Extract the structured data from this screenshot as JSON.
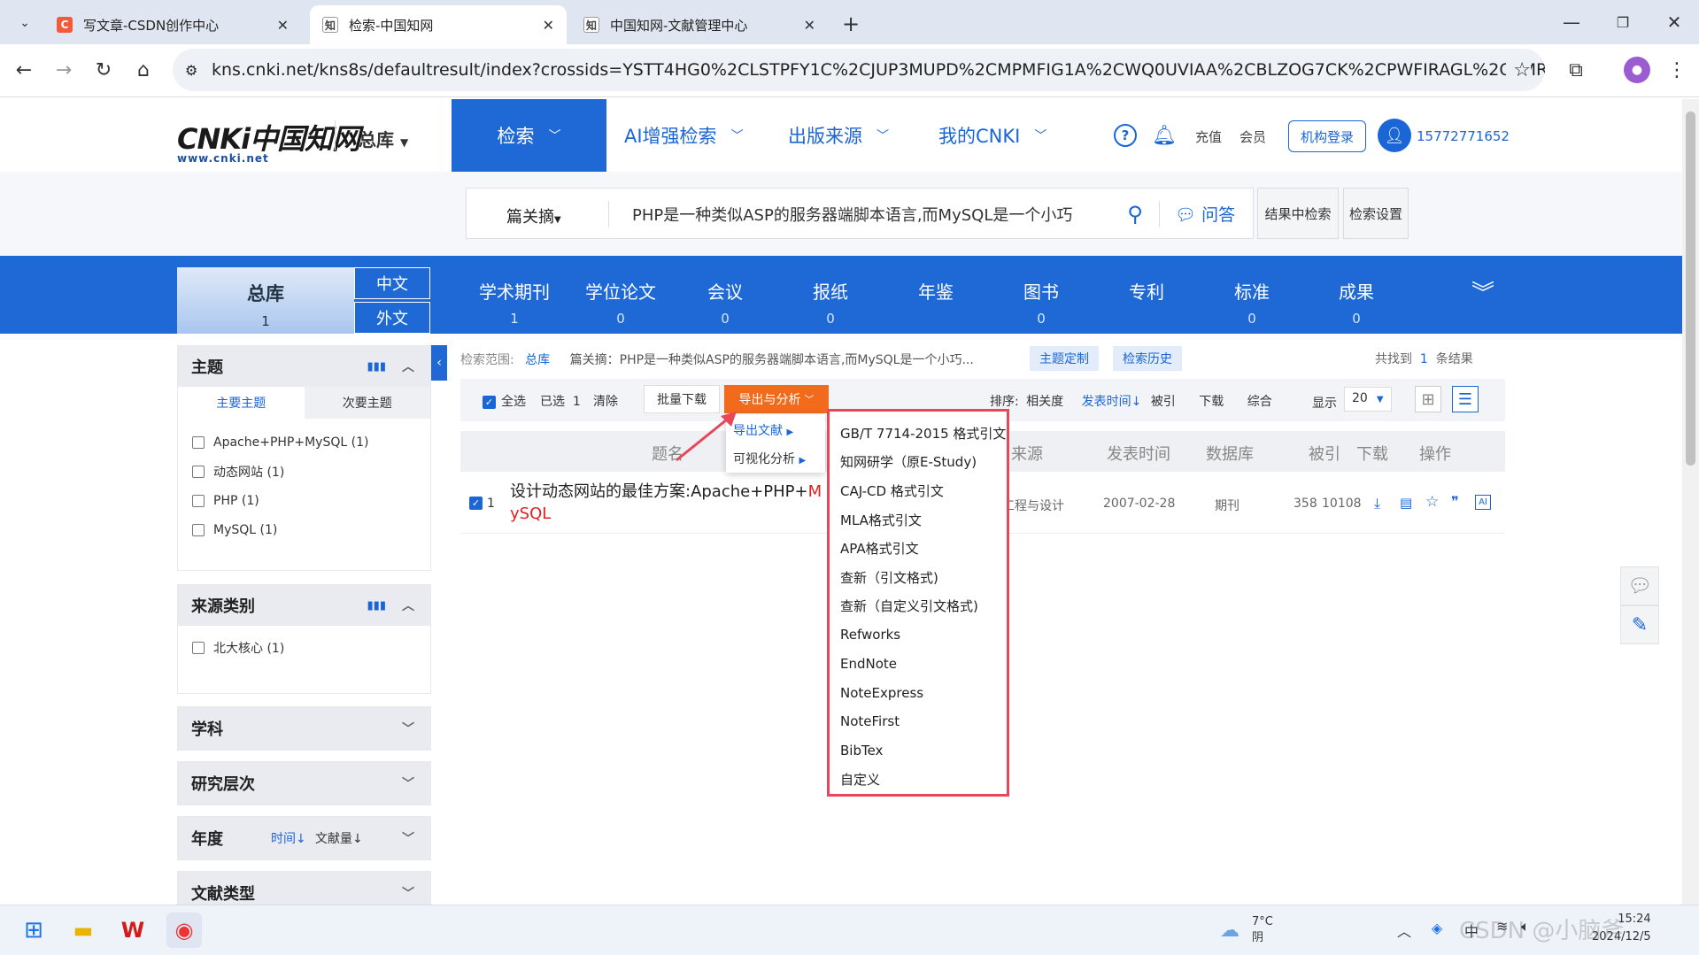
{
  "browser": {
    "tabs": [
      {
        "label": "写文章-CSDN创作中心",
        "fav": "C",
        "color": "#f25a3b"
      },
      {
        "label": "检索-中国知网",
        "fav": "知",
        "color": "#555"
      },
      {
        "label": "中国知网-文献管理中心",
        "fav": "知",
        "color": "#555"
      }
    ],
    "url": "kns.cnki.net/kns8s/defaultresult/index?crossids=YSTT4HG0%2CLSTPFY1C%2CJUP3MUPD%2CMPMFIG1A%2CWQ0UVIAA%2CBLZOG7CK%2CPWFIRAGL%2CEMRPGLPA%2C..."
  },
  "header": {
    "logo": "CNKi中国知网",
    "logo_sub": "www.cnki.net",
    "library": "总库",
    "nav": [
      "检索",
      "AI增强检索",
      "出版来源",
      "我的CNKI"
    ],
    "recharge": "充值",
    "member": "会员",
    "org_login": "机构登录",
    "user": "15772771652"
  },
  "search": {
    "field": "篇关摘",
    "query": "PHP是一种类似ASP的服务器端脚本语言,而MySQL是一个小巧",
    "qa": "问答",
    "in_results": "结果中检索",
    "settings": "检索设置"
  },
  "categories": {
    "main": {
      "label": "总库",
      "count": "1"
    },
    "zh": "中文",
    "foreign": "外文",
    "items": [
      {
        "label": "学术期刊",
        "count": "1"
      },
      {
        "label": "学位论文",
        "count": "0"
      },
      {
        "label": "会议",
        "count": "0"
      },
      {
        "label": "报纸",
        "count": "0"
      },
      {
        "label": "年鉴",
        "count": ""
      },
      {
        "label": "图书",
        "count": "0"
      },
      {
        "label": "专利",
        "count": ""
      },
      {
        "label": "标准",
        "count": "0"
      },
      {
        "label": "成果",
        "count": "0"
      }
    ]
  },
  "sidebar": {
    "topic": {
      "title": "主题",
      "tab1": "主要主题",
      "tab2": "次要主题",
      "items": [
        "Apache+PHP+MySQL (1)",
        "动态网站 (1)",
        "PHP (1)",
        "MySQL (1)"
      ]
    },
    "source": {
      "title": "来源类别",
      "items": [
        "北大核心 (1)"
      ]
    },
    "subject": "学科",
    "level": "研究层次",
    "year": {
      "title": "年度",
      "sort1": "时间",
      "sort2": "文献量"
    },
    "doctype": "文献类型"
  },
  "results": {
    "scope_label": "检索范围:",
    "scope_value": "总库",
    "scope_query": "篇关摘：PHP是一种类似ASP的服务器端脚本语言,而MySQL是一个小巧...",
    "theme_btn": "主题定制",
    "history_btn": "检索历史",
    "found_prefix": "共找到",
    "found_count": "1",
    "found_suffix": "条结果",
    "select_all": "全选",
    "selected": "已选",
    "selected_count": "1",
    "clear": "清除",
    "batch_download": "批量下载",
    "export": "导出与分析",
    "sort_label": "排序:",
    "sort_relevance": "相关度",
    "sort_date": "发表时间",
    "sort_cited": "被引",
    "sort_download": "下载",
    "sort_overall": "综合",
    "show_label": "显示",
    "page_size": "20",
    "columns": [
      "题名",
      "来源",
      "发表时间",
      "数据库",
      "被引",
      "下载",
      "操作"
    ],
    "row": {
      "index": "1",
      "title_a": "设计动态网站的最佳方案:Apache+PHP+",
      "title_hl1": "M",
      "title_hl2": "ySQL",
      "source": "工程与设计",
      "date": "2007-02-28",
      "db": "期刊",
      "cited": "358",
      "downloads": "10108"
    }
  },
  "submenu": [
    "导出文献",
    "可视化分析"
  ],
  "export_menu": [
    "GB/T 7714-2015 格式引文",
    "知网研学（原E-Study)",
    "CAJ-CD 格式引文",
    "MLA格式引文",
    "APA格式引文",
    "查新（引文格式)",
    "查新（自定义引文格式)",
    "Refworks",
    "EndNote",
    "NoteExpress",
    "NoteFirst",
    "BibTex",
    "自定义"
  ],
  "taskbar": {
    "temp": "7°C",
    "weather": "阴",
    "ime": "中",
    "time": "15:24",
    "date": "2024/12/5"
  },
  "watermark": "CSDN @小脑斧"
}
